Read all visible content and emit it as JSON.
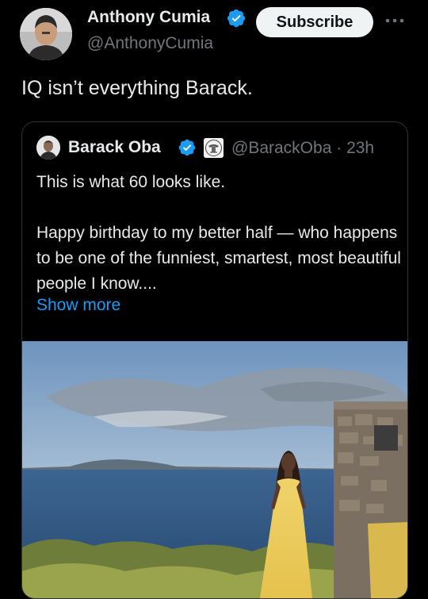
{
  "tweet": {
    "author_name": "Anthony Cumia",
    "author_handle": "@AnthonyCumia",
    "subscribe_label": "Subscribe",
    "text": "IQ isn’t everything Barack."
  },
  "quoted_tweet": {
    "author_name": "Barack Oba",
    "author_handle": "@BarackOba",
    "separator": "·",
    "age": "23h",
    "line1": "This is what 60 looks like.",
    "paragraph2": "Happy birthday to my better half — who happens to be one of the funniest, smartest, most beautiful people I know....",
    "show_more_label": "Show more"
  },
  "icons": {
    "verified": "verified-badge-icon",
    "affiliate": "government-seal-icon",
    "more": "more-options-icon"
  },
  "colors": {
    "background": "#000000",
    "text": "#e7e9ea",
    "secondary": "#71767b",
    "accent": "#1d9bf0",
    "button_bg": "#eff3f4",
    "border": "#2f3336"
  }
}
